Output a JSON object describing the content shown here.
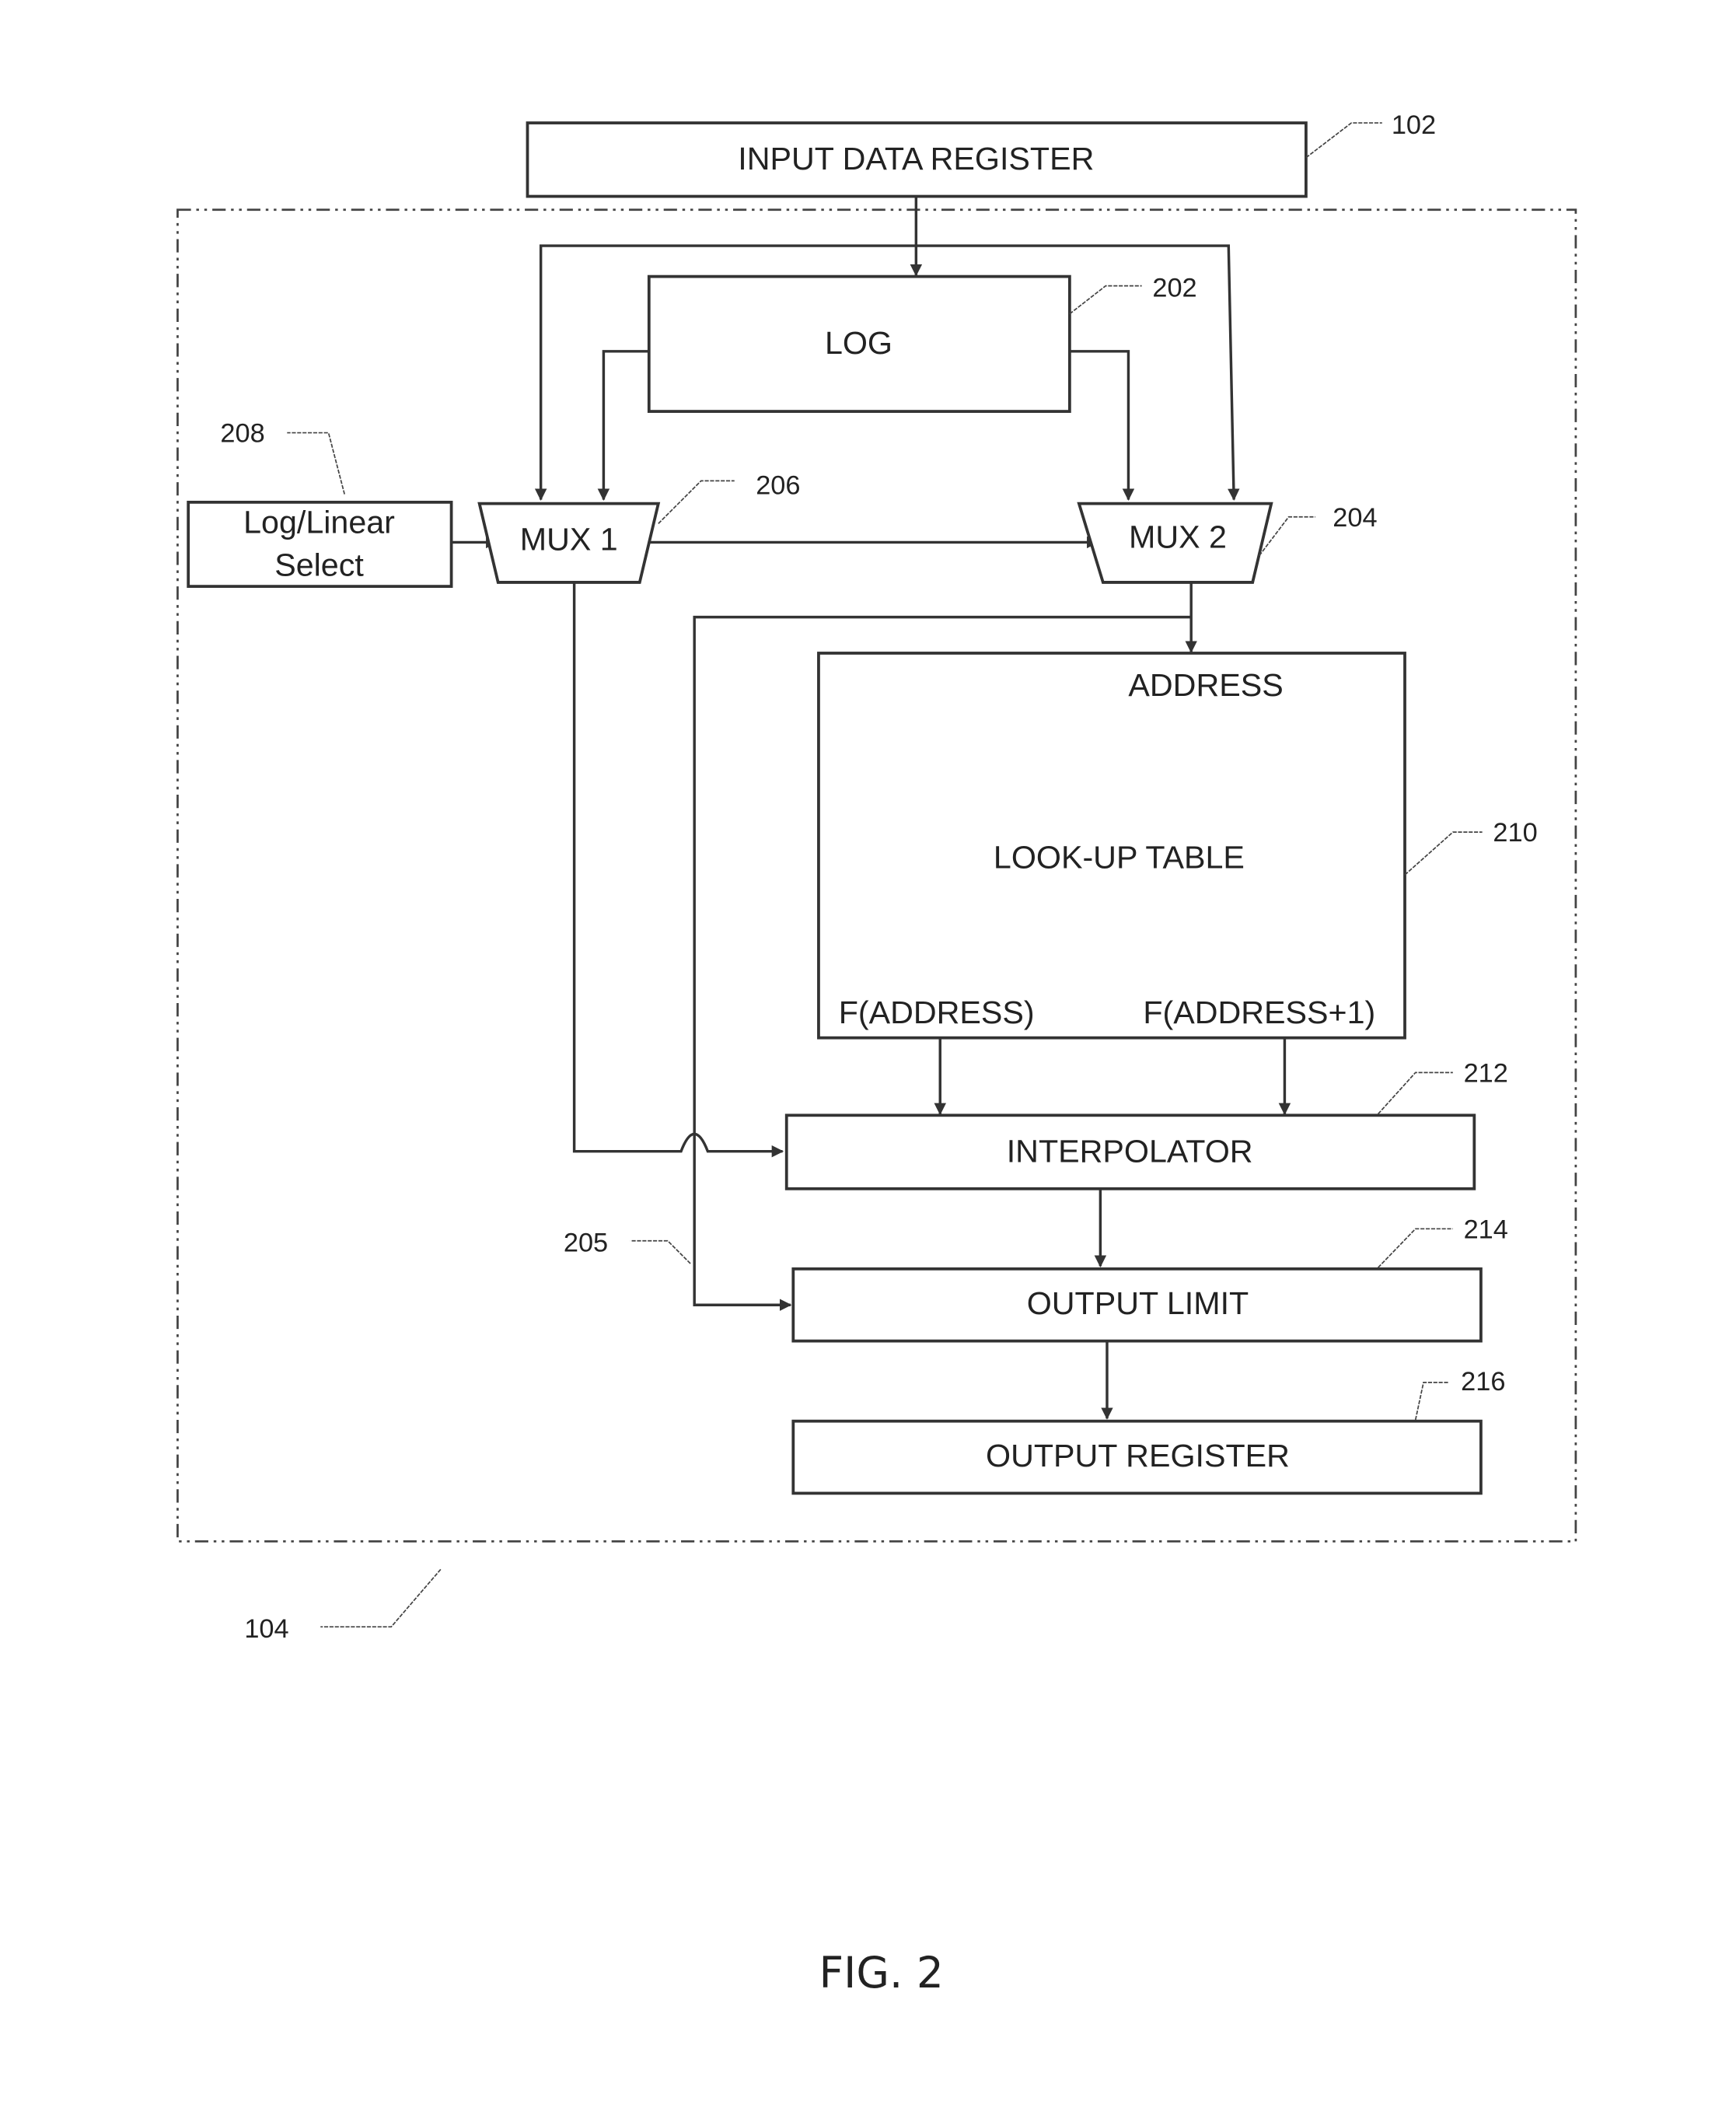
{
  "figure": {
    "caption": "FIG. 2",
    "blocks": {
      "input_data_register": {
        "label": "INPUT DATA REGISTER",
        "ref": "102"
      },
      "log": {
        "label": "LOG",
        "ref": "202"
      },
      "mux2": {
        "label": "MUX 2",
        "ref": "204"
      },
      "mux1": {
        "label": "MUX 1",
        "ref": "206"
      },
      "log_linear_select": {
        "label_line1": "Log/Linear",
        "label_line2": "Select",
        "ref": "208"
      },
      "lookup_table": {
        "label": "LOOK-UP TABLE",
        "address_label": "ADDRESS",
        "out_left_label": "F(ADDRESS)",
        "out_right_label": "F(ADDRESS+1)",
        "ref": "210"
      },
      "interpolator": {
        "label": "INTERPOLATOR",
        "ref": "212"
      },
      "output_limit": {
        "label": "OUTPUT LIMIT",
        "ref": "214"
      },
      "output_register": {
        "label": "OUTPUT REGISTER",
        "ref": "216"
      }
    },
    "signal_ref": "205",
    "boundary_ref": "104"
  }
}
